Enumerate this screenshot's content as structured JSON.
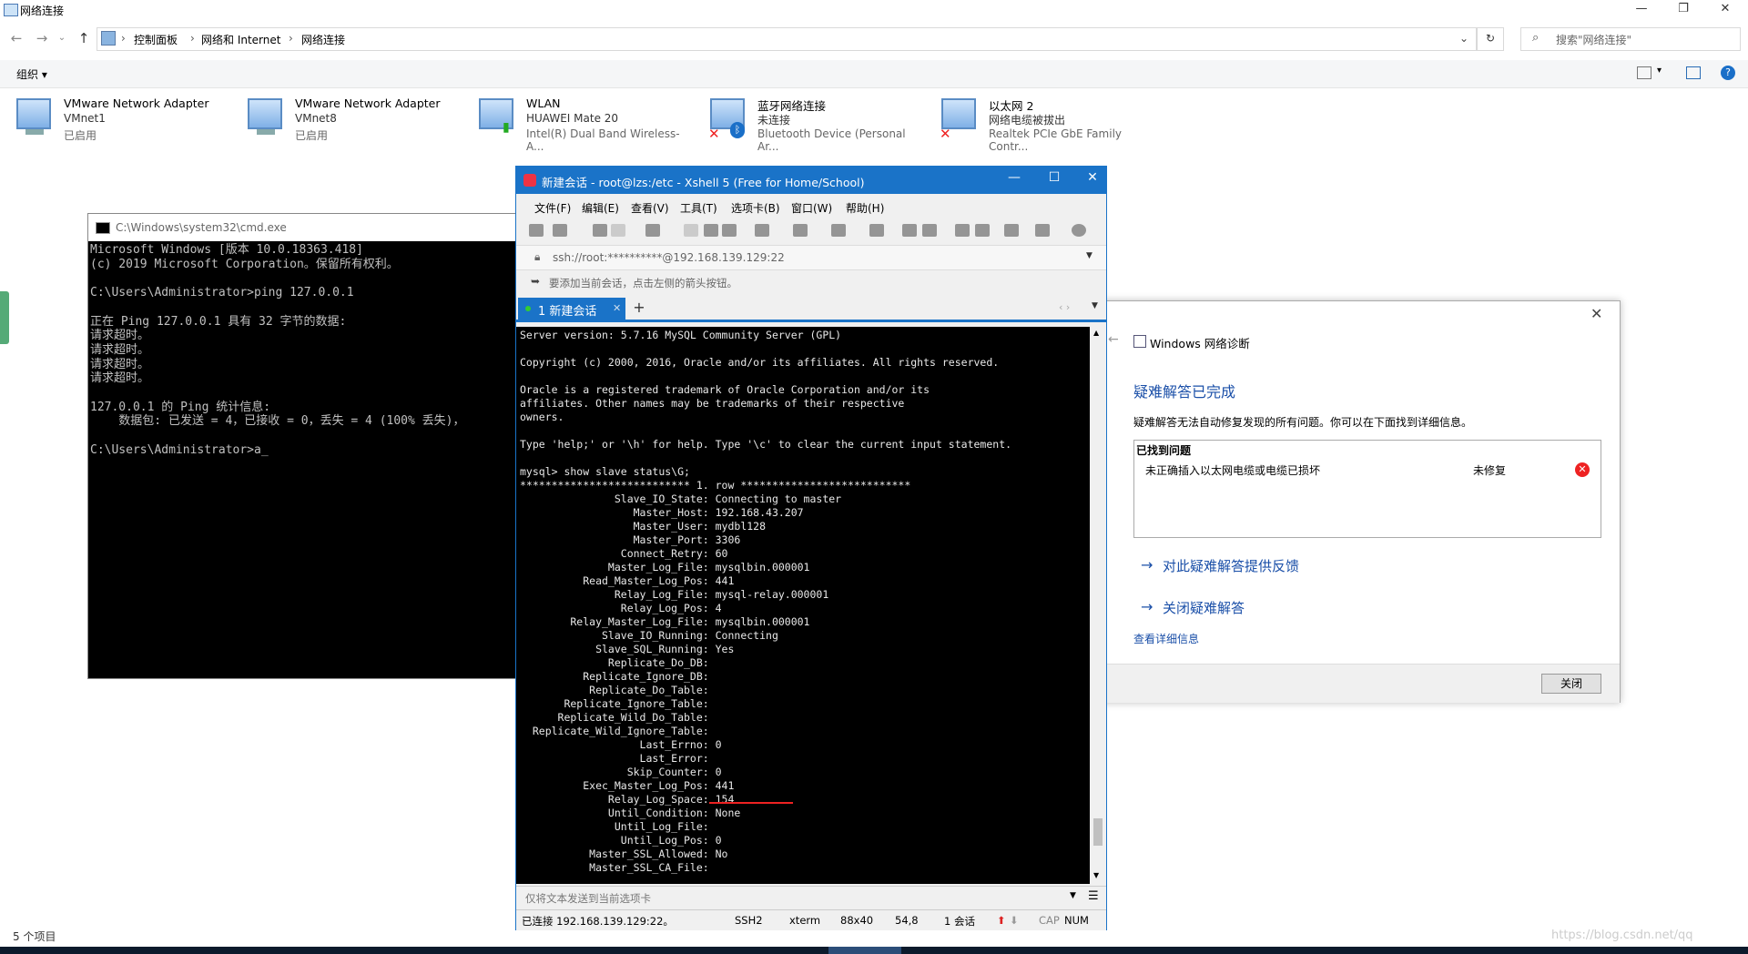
{
  "explorer": {
    "window_title": "网络连接",
    "breadcrumb": [
      "控制面板",
      "网络和 Internet",
      "网络连接"
    ],
    "search_placeholder": "搜索\"网络连接\"",
    "organize_label": "组织 ▾",
    "status_items": "5 个项目",
    "adapters": [
      {
        "name": "VMware Network Adapter",
        "sub": "VMnet1",
        "status": "已启用",
        "icon": "network-adapter-icon",
        "error": false
      },
      {
        "name": "VMware Network Adapter",
        "sub": "VMnet8",
        "status": "已启用",
        "icon": "network-adapter-icon",
        "error": false
      },
      {
        "name": "WLAN",
        "sub": "HUAWEI Mate 20",
        "status": "Intel(R) Dual Band Wireless-A...",
        "icon": "wifi-adapter-icon",
        "error": false
      },
      {
        "name": "蓝牙网络连接",
        "sub": "未连接",
        "status": "Bluetooth Device (Personal Ar...",
        "icon": "bluetooth-adapter-icon",
        "error": true
      },
      {
        "name": "以太网 2",
        "sub": "网络电缆被拔出",
        "status": "Realtek PCIe GbE Family Contr...",
        "icon": "ethernet-adapter-icon",
        "error": true
      }
    ]
  },
  "cmd": {
    "title": "C:\\Windows\\system32\\cmd.exe",
    "content": "Microsoft Windows [版本 10.0.18363.418]\n(c) 2019 Microsoft Corporation。保留所有权利。\n\nC:\\Users\\Administrator>ping 127.0.0.1\n\n正在 Ping 127.0.0.1 具有 32 字节的数据:\n请求超时。\n请求超时。\n请求超时。\n请求超时。\n\n127.0.0.1 的 Ping 统计信息:\n    数据包: 已发送 = 4，已接收 = 0，丢失 = 4 (100% 丢失)，\n\nC:\\Users\\Administrator>a_"
  },
  "xshell": {
    "title": "新建会话 - root@lzs:/etc - Xshell 5 (Free for Home/School)",
    "menu": [
      "文件(F)",
      "编辑(E)",
      "查看(V)",
      "工具(T)",
      "选项卡(B)",
      "窗口(W)",
      "帮助(H)"
    ],
    "ssh_address": "ssh://root:**********@192.168.139.129:22",
    "hint": "要添加当前会话，点击左侧的箭头按钮。",
    "tab_label": "1 新建会话",
    "send_placeholder": "仅将文本发送到当前选项卡",
    "terminal": "Server version: 5.7.16 MySQL Community Server (GPL)\n\nCopyright (c) 2000, 2016, Oracle and/or its affiliates. All rights reserved.\n\nOracle is a registered trademark of Oracle Corporation and/or its\naffiliates. Other names may be trademarks of their respective\nowners.\n\nType 'help;' or '\\h' for help. Type '\\c' to clear the current input statement.\n\nmysql> show slave status\\G;\n*************************** 1. row ***************************\n               Slave_IO_State: Connecting to master\n                  Master_Host: 192.168.43.207\n                  Master_User: mydbl128\n                  Master_Port: 3306\n                Connect_Retry: 60\n              Master_Log_File: mysqlbin.000001\n          Read_Master_Log_Pos: 441\n               Relay_Log_File: mysql-relay.000001\n                Relay_Log_Pos: 4\n        Relay_Master_Log_File: mysqlbin.000001\n             Slave_IO_Running: Connecting\n            Slave_SQL_Running: Yes\n              Replicate_Do_DB:\n          Replicate_Ignore_DB:\n           Replicate_Do_Table:\n       Replicate_Ignore_Table:\n      Replicate_Wild_Do_Table:\n  Replicate_Wild_Ignore_Table:\n                   Last_Errno: 0\n                   Last_Error:\n                 Skip_Counter: 0\n          Exec_Master_Log_Pos: 441\n              Relay_Log_Space: 154\n              Until_Condition: None\n               Until_Log_File:\n                Until_Log_Pos: 0\n           Master_SSL_Allowed: No\n           Master_SSL_CA_File:",
    "status": {
      "connection": "已连接 192.168.139.129:22。",
      "protocol": "SSH2",
      "term": "xterm",
      "size": "88x40",
      "pos": "54,8",
      "sessions": "1 会话",
      "caps": "CAP",
      "num": "NUM"
    }
  },
  "diag": {
    "header": "Windows 网络诊断",
    "heading": "疑难解答已完成",
    "description": "疑难解答无法自动修复发现的所有问题。你可以在下面找到详细信息。",
    "problems_title": "已找到问题",
    "problem_text": "未正确插入以太网电缆或电缆已损坏",
    "problem_status": "未修复",
    "link_feedback": "对此疑难解答提供反馈",
    "link_close": "关闭疑难解答",
    "details_link": "查看详细信息",
    "close_button": "关闭"
  },
  "watermark": "https://blog.csdn.net/qq",
  "colors": {
    "xshell_blue": "#1a73c8",
    "link_blue": "#1a4fa8",
    "error_red": "#e22222"
  }
}
